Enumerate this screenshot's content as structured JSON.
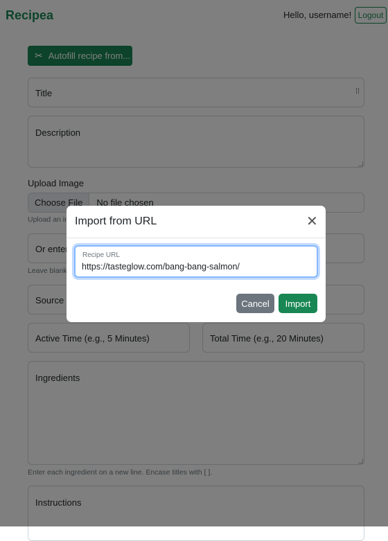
{
  "navbar": {
    "brand": "Recipea",
    "greeting": "Hello, username!",
    "logout_label": "Logout"
  },
  "form": {
    "autofill_label": "Autofill recipe from...",
    "autofill_icon": "scissors-icon",
    "title_placeholder": "Title",
    "description_placeholder": "Description",
    "upload_label": "Upload Image",
    "choose_file_label": "Choose File",
    "no_file_text": "No file chosen",
    "upload_help": "Upload an image (optional).",
    "image_url_placeholder": "Or enter an image URL",
    "image_url_help": "Leave blank if uploading an image.",
    "source_placeholder": "Source",
    "active_time_placeholder": "Active Time (e.g., 5 Minutes)",
    "total_time_placeholder": "Total Time (e.g., 20 Minutes)",
    "ingredients_placeholder": "Ingredients",
    "ingredients_help": "Enter each ingredient on a new line. Encase titles with [ ].",
    "instructions_placeholder": "Instructions"
  },
  "modal": {
    "title": "Import from URL",
    "close_icon": "close-icon",
    "url_label": "Recipe URL",
    "url_value": "https://tasteglow.com/bang-bang-salmon/",
    "cancel_label": "Cancel",
    "import_label": "Import"
  },
  "colors": {
    "brand_green": "#198754",
    "secondary_gray": "#6c757d",
    "focus_blue": "#86b7fe"
  }
}
